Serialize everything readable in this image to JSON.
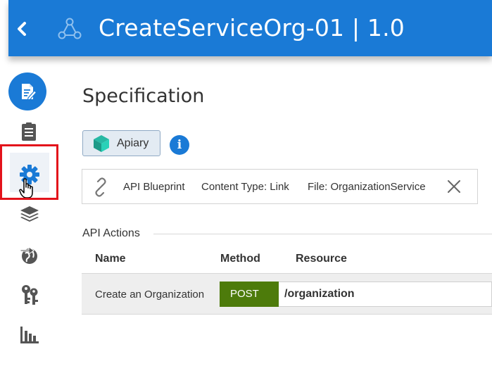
{
  "header": {
    "title": "CreateServiceOrg-01 | 1.0",
    "back_icon": "chevron-left-icon",
    "api_icon": "api-network-icon",
    "color": "#1a7ad6"
  },
  "sidebar": {
    "items": [
      {
        "icon": "document-edit-icon",
        "active": true
      },
      {
        "icon": "clipboard-list-icon"
      },
      {
        "icon": "gear-icon",
        "hovered": true
      },
      {
        "icon": "layers-icon"
      },
      {
        "icon": "globe-arrow-icon"
      },
      {
        "icon": "keys-icon"
      },
      {
        "icon": "bar-chart-icon"
      }
    ],
    "highlight_color": "#e3131b"
  },
  "main": {
    "page_title": "Specification",
    "apiary_label": "Apiary",
    "info_glyph": "i",
    "blueprint": {
      "type": "API Blueprint",
      "content_type": "Content Type: Link",
      "file": "File: OrganizationService"
    },
    "actions": {
      "section_label": "API Actions",
      "columns": [
        "Name",
        "Method",
        "Resource"
      ],
      "rows": [
        {
          "name": "Create an Organization",
          "method": "POST",
          "resource": "/organization"
        }
      ]
    },
    "method_color": "#4d7b0b"
  }
}
